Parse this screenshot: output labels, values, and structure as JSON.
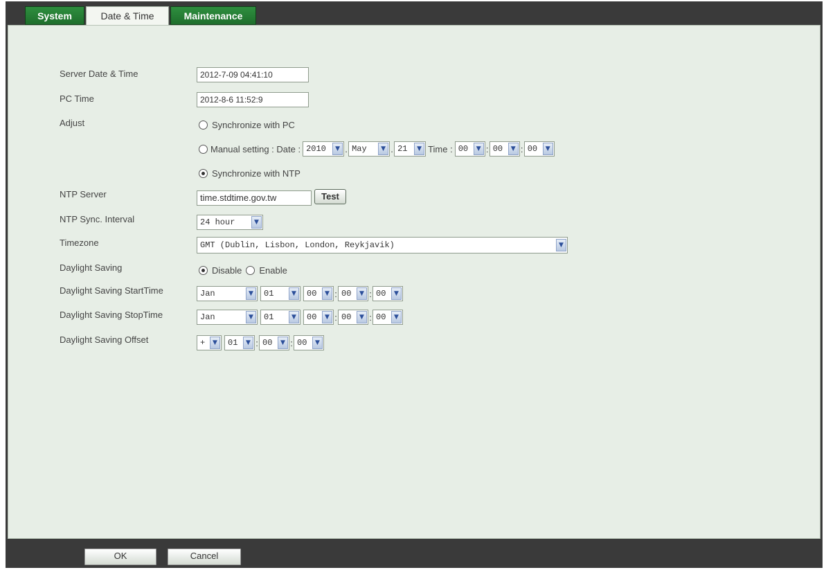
{
  "tabs": [
    {
      "label": "System",
      "active": false
    },
    {
      "label": "Date & Time",
      "active": true
    },
    {
      "label": "Maintenance",
      "active": false
    }
  ],
  "form": {
    "server_time": {
      "label": "Server Date & Time",
      "value": "2012-7-09 04:41:10"
    },
    "pc_time": {
      "label": "PC Time",
      "value": "2012-8-6 11:52:9"
    },
    "adjust": {
      "label": "Adjust",
      "sync_pc": "Synchronize with PC",
      "manual_prefix": "Manual setting : Date :",
      "date_year": "2010",
      "date_month": "May",
      "date_day": "21",
      "time_label": "Time :",
      "time_h": "00",
      "time_m": "00",
      "time_s": "00",
      "sync_ntp": "Synchronize with NTP",
      "selected": "ntp"
    },
    "ntp_server": {
      "label": "NTP Server",
      "value": "time.stdtime.gov.tw",
      "test_button": "Test"
    },
    "ntp_interval": {
      "label": "NTP Sync. Interval",
      "value": "24 hour"
    },
    "timezone": {
      "label": "Timezone",
      "value": "GMT (Dublin, Lisbon, London, Reykjavik)"
    },
    "daylight": {
      "label": "Daylight Saving",
      "disable": "Disable",
      "enable": "Enable",
      "selected": "disable"
    },
    "dst_start": {
      "label": "Daylight Saving StartTime",
      "month": "Jan",
      "day": "01",
      "h": "00",
      "m": "00",
      "s": "00"
    },
    "dst_stop": {
      "label": "Daylight Saving StopTime",
      "month": "Jan",
      "day": "01",
      "h": "00",
      "m": "00",
      "s": "00"
    },
    "dst_offset": {
      "label": "Daylight Saving Offset",
      "sign": "+",
      "h": "01",
      "m": "00",
      "s": "00"
    },
    "separator": ":",
    "date_separator": "."
  },
  "footer": {
    "ok": "OK",
    "cancel": "Cancel"
  },
  "colors": {
    "tab_green": "#2f8f3f",
    "panel_bg": "#e7eee6",
    "frame_dark": "#3a3a3a"
  },
  "icons": {
    "dropdown": "chevron-down-icon"
  }
}
